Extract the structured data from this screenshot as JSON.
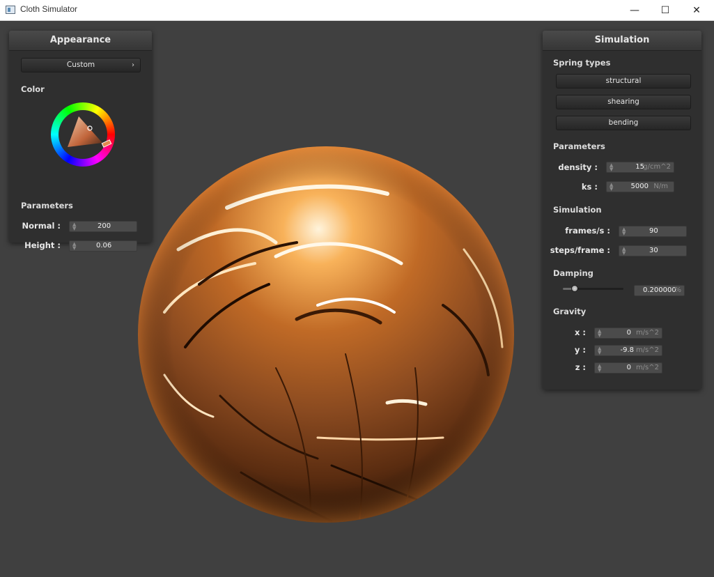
{
  "window": {
    "title": "Cloth Simulator",
    "minimize_glyph": "—",
    "maximize_glyph": "☐",
    "close_glyph": "✕"
  },
  "appearance": {
    "title": "Appearance",
    "shader_select": "Custom",
    "color_label": "Color",
    "parameters_label": "Parameters",
    "normal_label": "Normal :",
    "normal_value": "200",
    "height_label": "Height :",
    "height_value": "0.06"
  },
  "simulation": {
    "title": "Simulation",
    "spring_types_label": "Spring types",
    "spring_buttons": [
      "structural",
      "shearing",
      "bending"
    ],
    "parameters_label": "Parameters",
    "density_label": "density :",
    "density_value": "15",
    "density_unit": "g/cm^2",
    "ks_label": "ks :",
    "ks_value": "5000",
    "ks_unit": "N/m",
    "simulation_label": "Simulation",
    "fps_label": "frames/s :",
    "fps_value": "90",
    "steps_label": "steps/frame :",
    "steps_value": "30",
    "damping_label": "Damping",
    "damping_value": "0.200000",
    "damping_unit": "%",
    "damping_fraction": 0.2,
    "gravity_label": "Gravity",
    "gx_label": "x :",
    "gx_value": "0",
    "gy_label": "y :",
    "gy_value": "-9.8",
    "gz_label": "z :",
    "gz_value": "0",
    "gravity_unit": "m/s^2"
  },
  "colors": {
    "background": "#404040",
    "panel": "#2f2f2f",
    "sphere_highlight": "#ffd9a0",
    "sphere_mid": "#e07a20",
    "sphere_dark": "#5a2a0a"
  }
}
